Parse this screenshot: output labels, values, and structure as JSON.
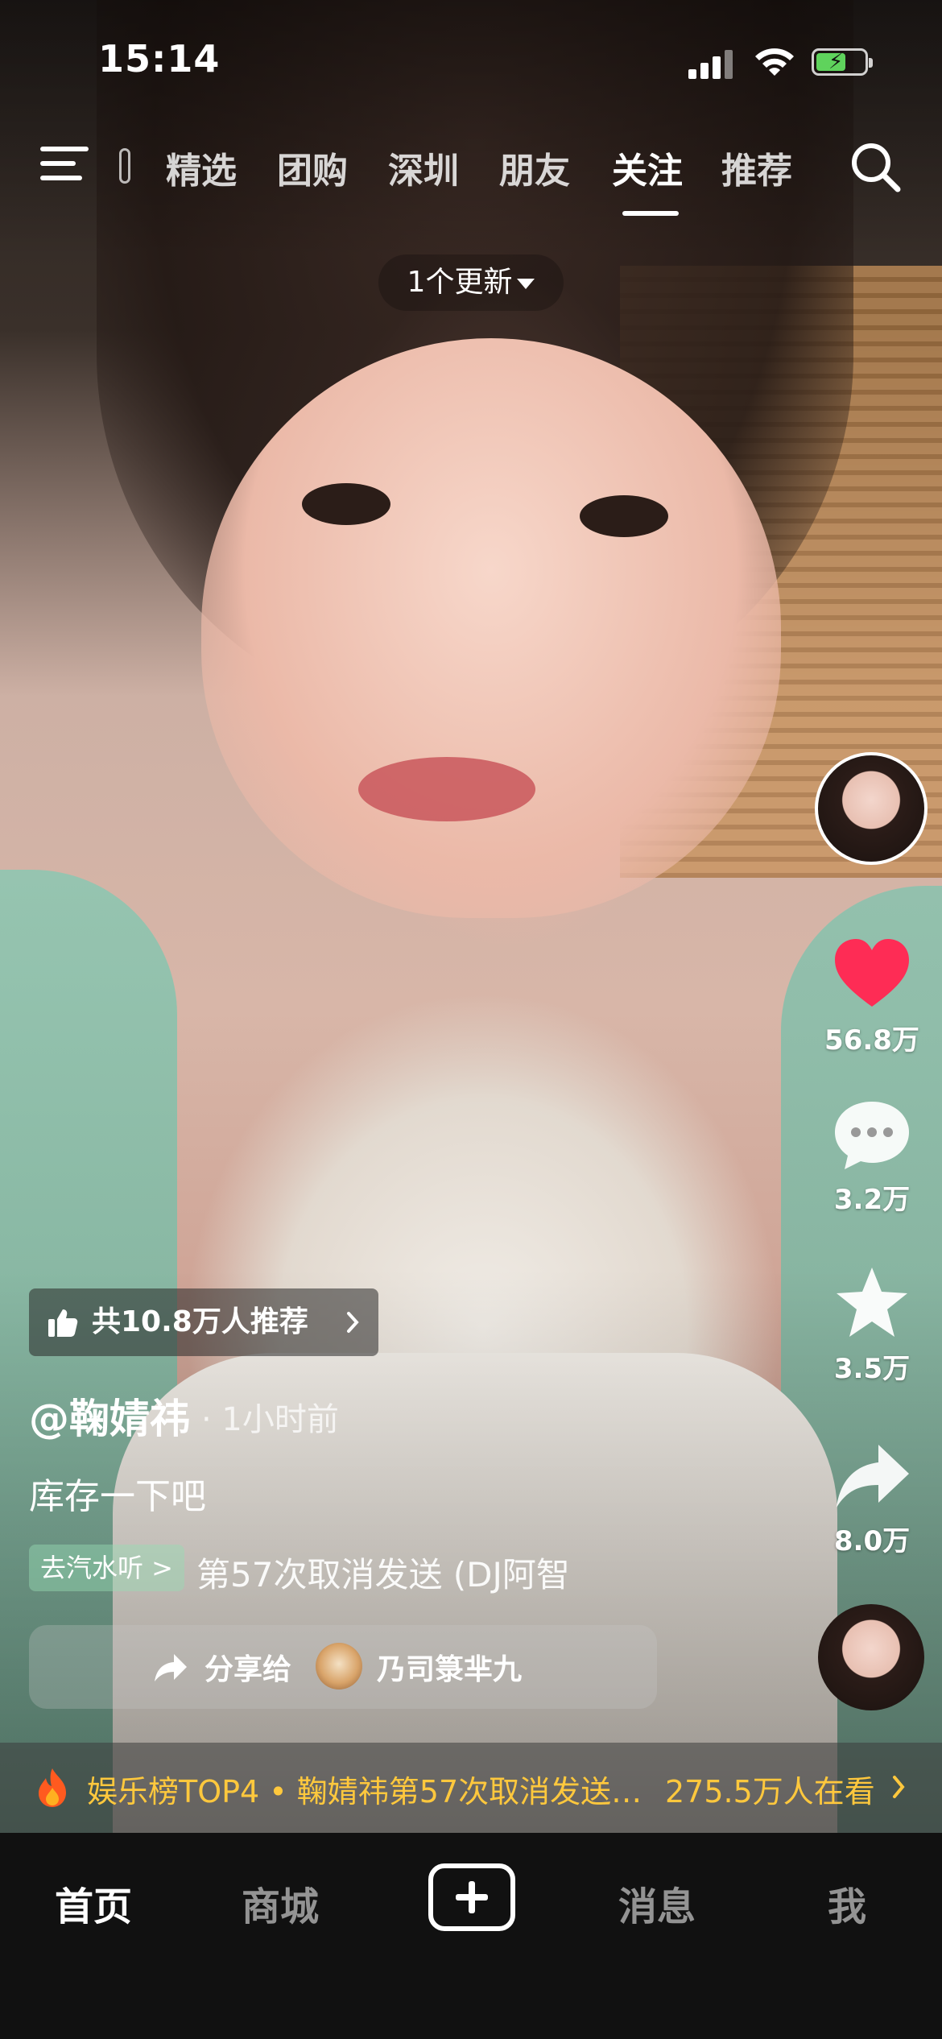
{
  "status_bar": {
    "time": "15:14"
  },
  "top_nav": {
    "tabs": [
      {
        "label": "精选"
      },
      {
        "label": "团购"
      },
      {
        "label": "深圳"
      },
      {
        "label": "朋友"
      },
      {
        "label": "关注",
        "active": true
      },
      {
        "label": "推荐"
      }
    ],
    "update_pill": "1个更新"
  },
  "right_rail": {
    "likes": "56.8万",
    "comments": "3.2万",
    "favorites": "3.5万",
    "shares": "8.0万",
    "like_color": "#fe2c55"
  },
  "post": {
    "recommend_chip": "共10.8万人推荐",
    "author": "@鞠婧祎",
    "time_ago": "· 1小时前",
    "caption": "库存一下吧",
    "music_tag": "去汽水听 >",
    "music_title": "第57次取消发送 (DJ阿智",
    "share_label": "分享给",
    "share_friend": "乃司箓芈九"
  },
  "hot_banner": {
    "text": "娱乐榜TOP4 • 鞠婧祎第57次取消发送…",
    "viewers": "275.5万人在看",
    "color": "#ffc83d"
  },
  "tab_bar": {
    "home": "首页",
    "mall": "商城",
    "messages": "消息",
    "me": "我"
  }
}
